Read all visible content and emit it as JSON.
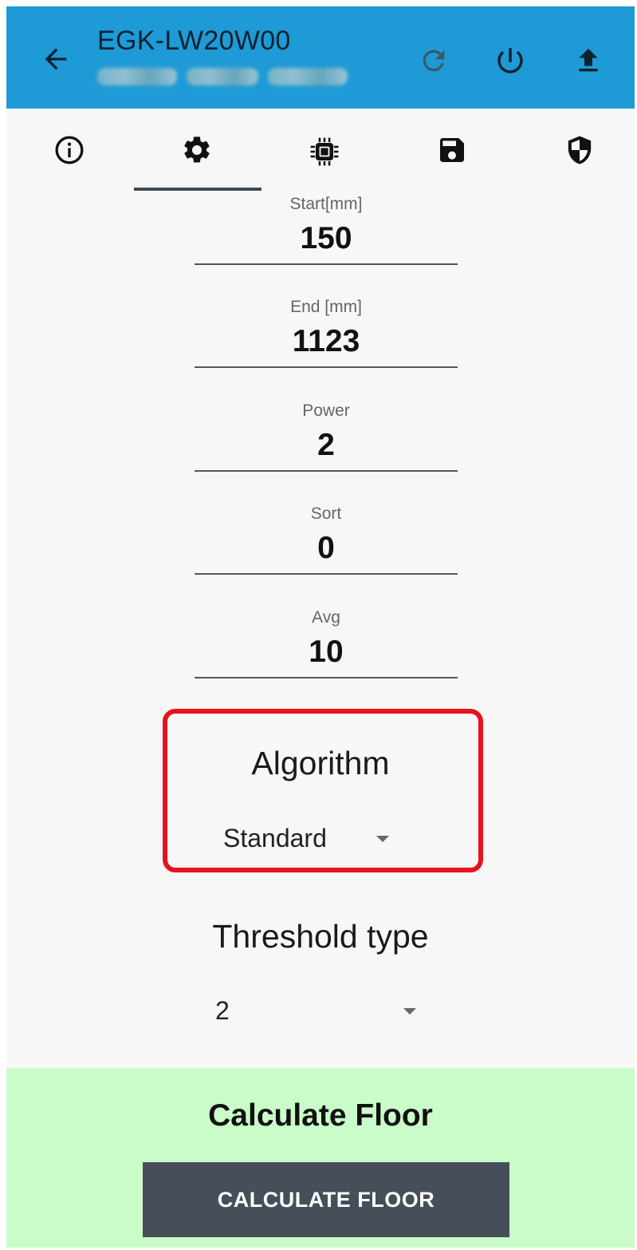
{
  "appbar": {
    "title": "EGK-LW20W00",
    "bg_color": "#1e9ad6",
    "back_icon": "arrow-left-icon",
    "actions": [
      {
        "icon": "refresh-icon"
      },
      {
        "icon": "power-icon"
      },
      {
        "icon": "upload-icon"
      }
    ]
  },
  "tabs": [
    {
      "icon": "info-icon",
      "selected": false
    },
    {
      "icon": "gear-icon",
      "selected": true
    },
    {
      "icon": "chip-icon",
      "selected": false
    },
    {
      "icon": "save-icon",
      "selected": false
    },
    {
      "icon": "shield-icon",
      "selected": false
    }
  ],
  "fields": [
    {
      "label": "Start[mm]",
      "value": "150"
    },
    {
      "label": "End [mm]",
      "value": "1123"
    },
    {
      "label": "Power",
      "value": "2"
    },
    {
      "label": "Sort",
      "value": "0"
    },
    {
      "label": "Avg",
      "value": "10"
    }
  ],
  "algorithm": {
    "title": "Algorithm",
    "selected": "Standard",
    "highlight_color": "#e8121c"
  },
  "threshold": {
    "title": "Threshold type",
    "selected": "2"
  },
  "calculate": {
    "heading": "Calculate Floor",
    "button_label": "CALCULATE FLOOR",
    "panel_color": "#cafcc9",
    "button_color": "#464e5a"
  }
}
